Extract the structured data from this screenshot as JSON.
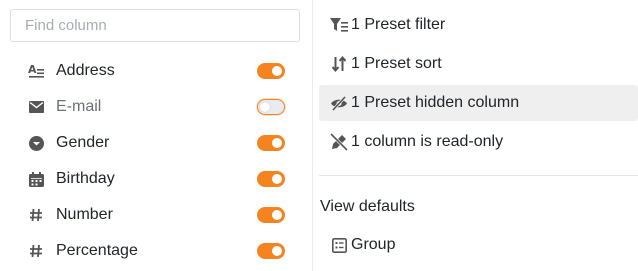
{
  "search": {
    "placeholder": "Find column"
  },
  "columns": [
    {
      "label": "Address",
      "icon": "text-icon",
      "enabled": true
    },
    {
      "label": "E-mail",
      "icon": "envelope-icon",
      "enabled": false
    },
    {
      "label": "Gender",
      "icon": "single-select-icon",
      "enabled": true
    },
    {
      "label": "Birthday",
      "icon": "calendar-icon",
      "enabled": true
    },
    {
      "label": "Number",
      "icon": "hash-icon",
      "enabled": true
    },
    {
      "label": "Percentage",
      "icon": "hash-icon",
      "enabled": true
    }
  ],
  "options": [
    {
      "label": "1 Preset filter",
      "icon": "filter-icon"
    },
    {
      "label": "1 Preset sort",
      "icon": "sort-icon"
    },
    {
      "label": "1 Preset hidden column",
      "icon": "eye-slash-icon",
      "highlighted": true
    },
    {
      "label": "1 column is read-only",
      "icon": "pen-slash-icon"
    }
  ],
  "view_defaults": {
    "title": "View defaults",
    "items": [
      {
        "label": "Group",
        "icon": "group-list-icon"
      }
    ]
  },
  "colors": {
    "accent": "#f48320",
    "text": "#212529",
    "muted": "#6c7177",
    "highlight": "#efefef"
  }
}
